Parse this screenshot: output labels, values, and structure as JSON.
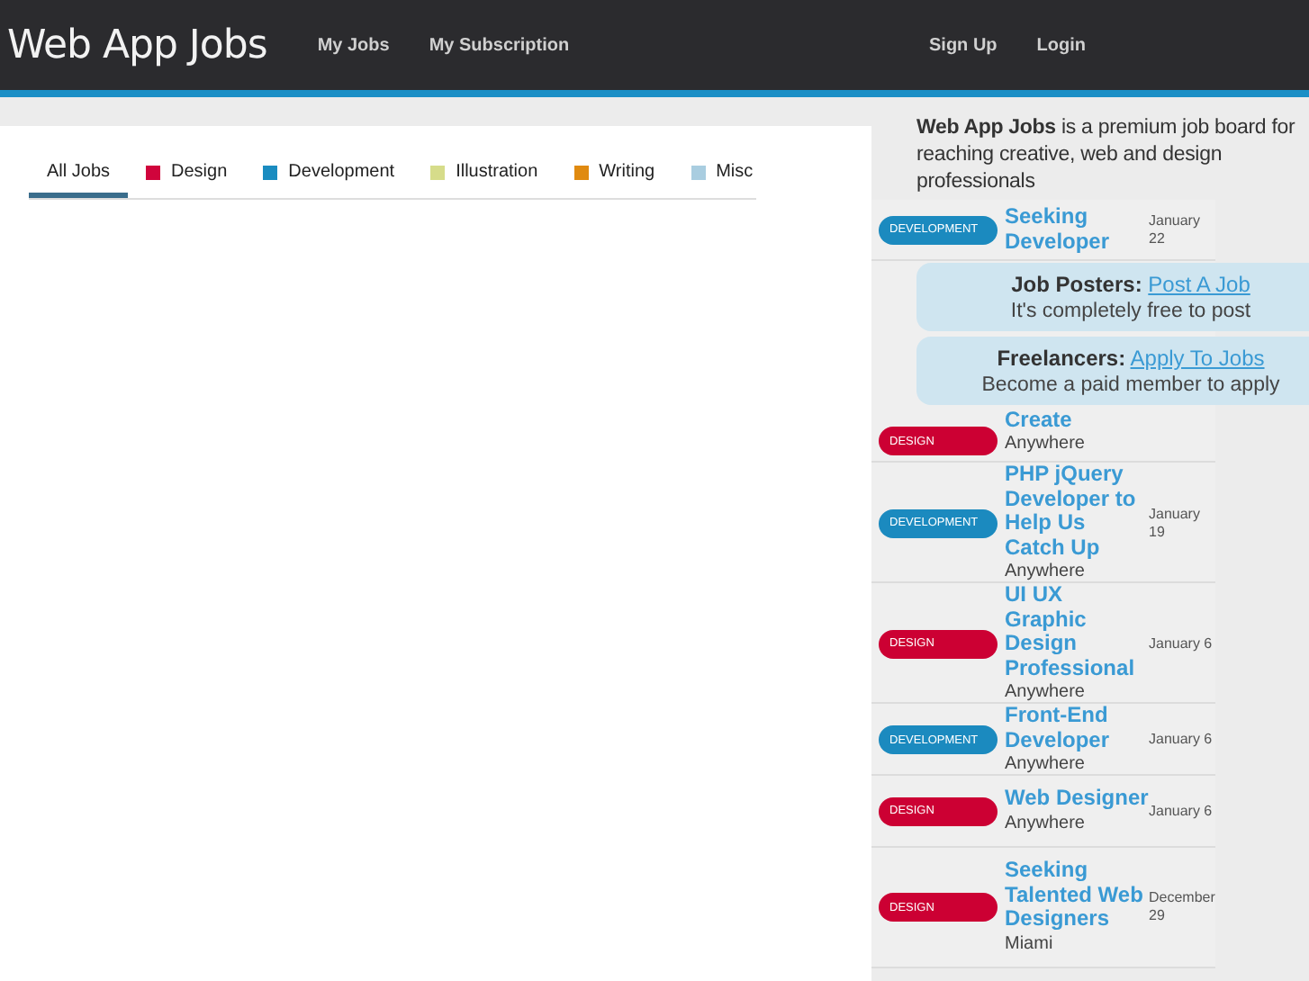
{
  "header": {
    "logo": "Web App Jobs",
    "nav": [
      "My Jobs",
      "My Subscription"
    ],
    "account": [
      "Sign Up",
      "Login"
    ]
  },
  "tabs": [
    {
      "label": "All Jobs",
      "selected": true
    },
    {
      "label": "Design",
      "selected": false,
      "color": "#d0043c"
    },
    {
      "label": "Development",
      "selected": false,
      "color": "#1a8cc0"
    },
    {
      "label": "Illustration",
      "selected": false,
      "color": "#d6dc8a"
    },
    {
      "label": "Writing",
      "selected": false,
      "color": "#e08a10"
    },
    {
      "label": "Misc",
      "selected": false,
      "color": "#a9cde0"
    }
  ],
  "intro": "**Web App Jobs** is a premium job board for reaching creative, web and design professionals",
  "callouts": [
    {
      "heading": "Job Posters:",
      "link": "Post A Job",
      "note": "It's completely free to post"
    },
    {
      "heading": "Freelancers:",
      "link": "Apply To Jobs",
      "note": "Become a paid member to apply"
    }
  ],
  "jobs": [
    {
      "category": "DEVELOPMENT",
      "kind": "development",
      "title": "Seeking Developer",
      "date": "January 22"
    },
    {
      "category": "DESIGN",
      "kind": "design",
      "title": "Create",
      "location": "Anywhere"
    },
    {
      "category": "DEVELOPMENT",
      "kind": "development",
      "title": "PHP jQuery Developer to Help Us Catch Up",
      "location": "Anywhere",
      "date": "January 19"
    },
    {
      "category": "DESIGN",
      "kind": "design",
      "title": "UI UX Graphic Design Professional",
      "location": "Anywhere",
      "date": "January 6"
    },
    {
      "category": "DEVELOPMENT",
      "kind": "development",
      "title": "Front-End Developer",
      "location": "Anywhere",
      "date": "January 6"
    },
    {
      "category": "DESIGN",
      "kind": "design",
      "title": "Web Designer",
      "location": "Anywhere",
      "date": "January 6"
    },
    {
      "category": "DESIGN",
      "kind": "design",
      "title": "Seeking Talented Web Designers",
      "location": "Miami",
      "date": "December 29"
    }
  ]
}
